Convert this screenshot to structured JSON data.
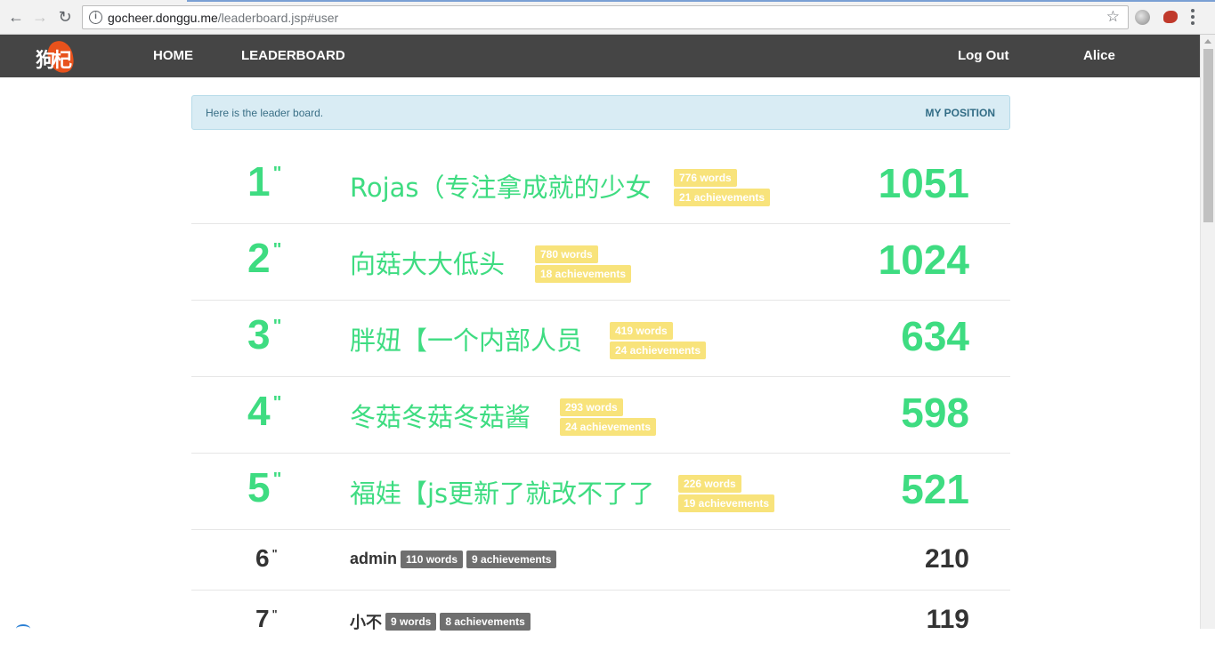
{
  "browser": {
    "url_domain": "gocheer.donggu.me",
    "url_path": "/leaderboard.jsp#user"
  },
  "navbar": {
    "logo_text": "狗杞",
    "home": "HOME",
    "leaderboard": "LEADERBOARD",
    "logout": "Log Out",
    "user": "Alice"
  },
  "alert": {
    "message": "Here is the leader board.",
    "my_position": "MY POSITION"
  },
  "entries": [
    {
      "rank": "1",
      "mark": "\"",
      "name": "Rojas（专注拿成就的少女",
      "words": "776 words",
      "achievements": "21 achievements",
      "score": "1051"
    },
    {
      "rank": "2",
      "mark": "\"",
      "name": "向菇大大低头",
      "words": "780 words",
      "achievements": "18 achievements",
      "score": "1024"
    },
    {
      "rank": "3",
      "mark": "\"",
      "name": "胖妞【一个内部人员",
      "words": "419 words",
      "achievements": "24 achievements",
      "score": "634"
    },
    {
      "rank": "4",
      "mark": "\"",
      "name": "冬菇冬菇冬菇酱",
      "words": "293 words",
      "achievements": "24 achievements",
      "score": "598"
    },
    {
      "rank": "5",
      "mark": "\"",
      "name": "福娃【js更新了就改不了了",
      "words": "226 words",
      "achievements": "19 achievements",
      "score": "521"
    },
    {
      "rank": "6",
      "mark": "\"",
      "name": "admin",
      "words": "110 words",
      "achievements": "9 achievements",
      "score": "210"
    },
    {
      "rank": "7",
      "mark": "\"",
      "name": "小不",
      "words": "9 words",
      "achievements": "8 achievements",
      "score": "119"
    }
  ],
  "colors": {
    "navbar": "#454545",
    "top_green": "#3edc81",
    "tag_yellow": "#f8e37b",
    "tag_gray": "#6f6f6f",
    "alert_bg": "#d9ecf4"
  }
}
